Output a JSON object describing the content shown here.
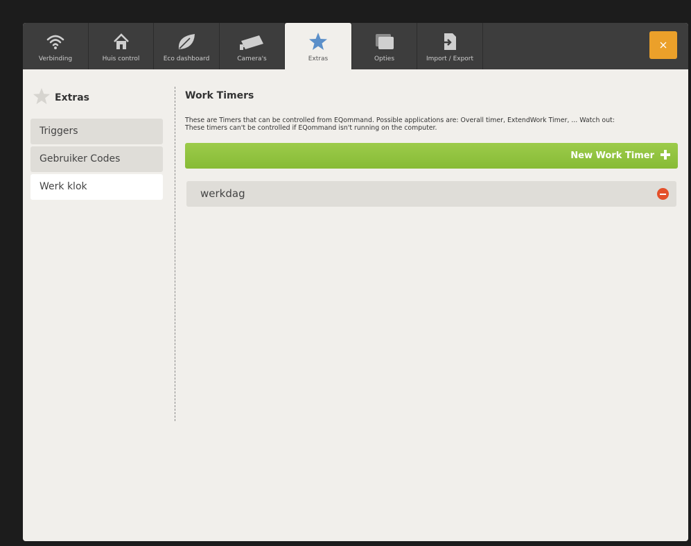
{
  "tabs": [
    {
      "label": "Verbinding",
      "icon": "wifi-icon"
    },
    {
      "label": "Huis control",
      "icon": "house-icon"
    },
    {
      "label": "Eco dashboard",
      "icon": "leaf-icon"
    },
    {
      "label": "Camera's",
      "icon": "camera-icon"
    },
    {
      "label": "Extras",
      "icon": "star-icon",
      "active": true
    },
    {
      "label": "Opties",
      "icon": "options-icon"
    },
    {
      "label": "Import / Export",
      "icon": "import-export-icon"
    }
  ],
  "close_button": {
    "icon": "close-icon",
    "color": "#eba02a"
  },
  "sidebar": {
    "title": "Extras",
    "items": [
      {
        "label": "Triggers"
      },
      {
        "label": "Gebruiker Codes"
      },
      {
        "label": "Werk klok",
        "active": true
      }
    ]
  },
  "main": {
    "title": "Work Timers",
    "description_line1": "These are Timers that can be controlled from EQommand. Possible applications are: Overall timer, ExtendWork Timer, ... Watch out:",
    "description_line2": "These timers can't be controlled if EQommand isn't running on the computer.",
    "new_button_label": "New Work Timer",
    "timers": [
      {
        "name": "werkdag"
      }
    ]
  },
  "colors": {
    "accent_green": "#8cc03b",
    "remove_red": "#e4502a",
    "active_star": "#5b8fc9"
  }
}
